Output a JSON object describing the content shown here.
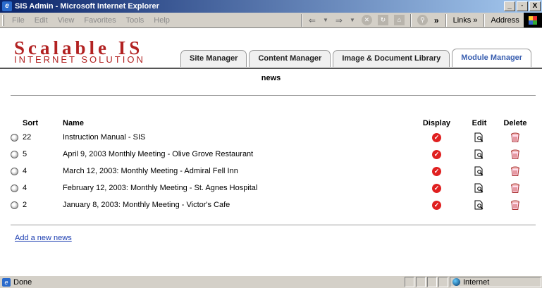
{
  "window": {
    "title": "SIS Admin - Microsoft Internet Explorer",
    "controls": [
      "_",
      "·",
      "X"
    ]
  },
  "menubar": {
    "items": [
      "File",
      "Edit",
      "View",
      "Favorites",
      "Tools",
      "Help"
    ],
    "links_label": "Links »",
    "address_label": "Address"
  },
  "logo": {
    "main": "Scalable IS",
    "sub": "INTERNET SOLUTION",
    "color": "#b22222"
  },
  "tabs": [
    {
      "label": "Site Manager",
      "active": false
    },
    {
      "label": "Content Manager",
      "active": false
    },
    {
      "label": "Image & Document Library",
      "active": false
    },
    {
      "label": "Module Manager",
      "active": true
    }
  ],
  "page": {
    "title": "news",
    "add_link": "Add a new news"
  },
  "table": {
    "headers": {
      "sort": "Sort",
      "name": "Name",
      "display": "Display",
      "edit": "Edit",
      "delete": "Delete"
    },
    "rows": [
      {
        "sort": "22",
        "name": "Instruction Manual - SIS"
      },
      {
        "sort": "5",
        "name": "April 9, 2003 Monthly Meeting - Olive Grove Restaurant"
      },
      {
        "sort": "4",
        "name": "March 12, 2003: Monthly Meeting - Admiral Fell Inn"
      },
      {
        "sort": "4",
        "name": "February 12, 2003: Monthly Meeting - St. Agnes Hospital"
      },
      {
        "sort": "2",
        "name": "January 8, 2003: Monthly Meeting - Victor's Cafe"
      }
    ]
  },
  "statusbar": {
    "status": "Done",
    "zone": "Internet"
  },
  "icons": {
    "display": "checkmark-icon",
    "edit": "magnifier-document-icon",
    "delete": "trash-icon",
    "select": "radio-icon"
  },
  "colors": {
    "accent_tab": "#3a5fb0",
    "link": "#1a3cb0",
    "display_icon": "#e02020"
  }
}
